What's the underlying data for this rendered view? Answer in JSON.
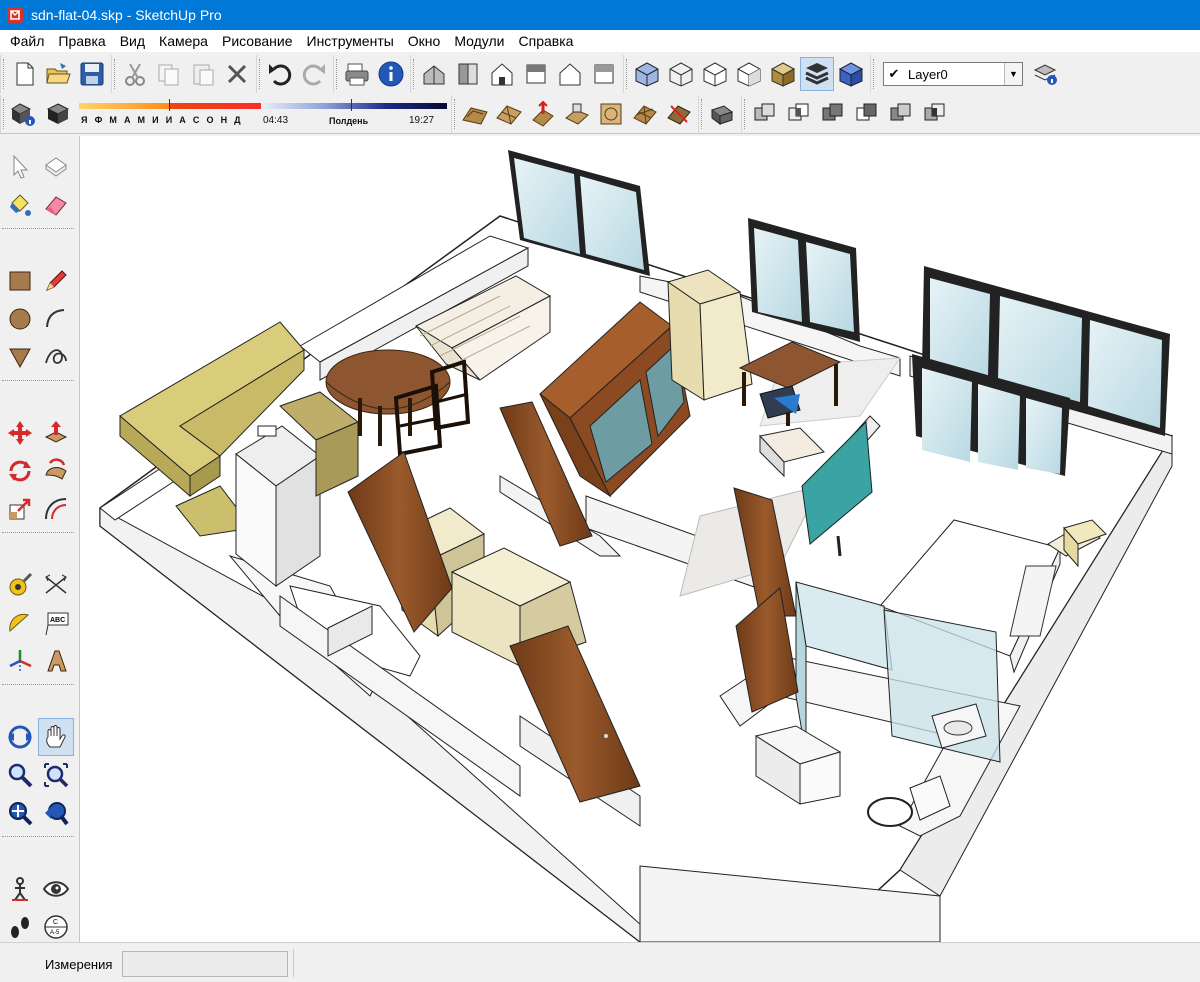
{
  "window": {
    "title": "sdn-flat-04.skp - SketchUp Pro"
  },
  "menu": [
    "Файл",
    "Правка",
    "Вид",
    "Камера",
    "Рисование",
    "Инструменты",
    "Окно",
    "Модули",
    "Справка"
  ],
  "layer": {
    "checked": "✔",
    "value": "Layer0"
  },
  "shadows": {
    "months": "Я Ф М А М И И А С О Н Д",
    "time_start": "04:43",
    "noon": "Полдень",
    "time_end": "19:27"
  },
  "colors": {
    "titlebar": "#0078d7",
    "wood": "#8b4a22",
    "glass": "#d4e9ef",
    "wall": "#ffffff",
    "kitchen": "#cbbf6e",
    "teal": "#3aa3a3"
  },
  "status": {
    "measurements_label": "Измерения",
    "measurements_value": ""
  }
}
